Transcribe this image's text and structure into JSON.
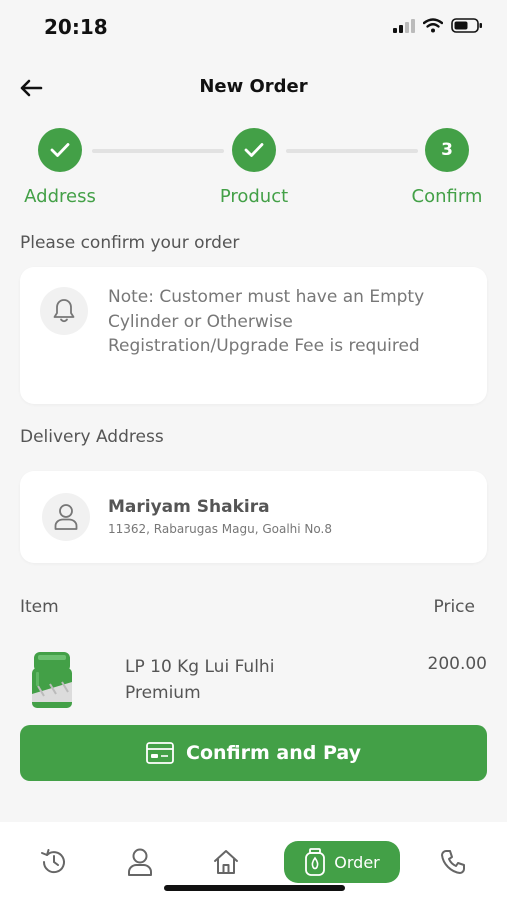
{
  "status": {
    "time": "20:18"
  },
  "header": {
    "title": "New Order"
  },
  "stepper": {
    "steps": [
      {
        "label": "Address",
        "state": "done",
        "mark": ""
      },
      {
        "label": "Product",
        "state": "done",
        "mark": ""
      },
      {
        "label": "Confirm",
        "state": "current",
        "mark": "3"
      }
    ]
  },
  "confirm_section": {
    "heading": "Please confirm your order",
    "note": "Note: Customer must have an Empty Cylinder or Otherwise Registration/Upgrade Fee is required"
  },
  "delivery": {
    "heading": "Delivery Address",
    "name": "Mariyam Shakira",
    "address": "11362, Rabarugas Magu, Goalhi No.8"
  },
  "items": {
    "col_item": "Item",
    "col_price": "Price",
    "rows": [
      {
        "name": "LP 10 Kg Lui Fulhi Premium",
        "price": "200.00"
      }
    ]
  },
  "actions": {
    "confirm_label": "Confirm and Pay"
  },
  "tabbar": {
    "tabs": [
      "history-icon",
      "profile-icon",
      "home-icon",
      "order-icon",
      "phone-icon"
    ],
    "active_label": "Order"
  },
  "colors": {
    "accent": "#43a047",
    "background": "#f6f6f6",
    "card": "#ffffff",
    "muted_text": "#777777"
  }
}
